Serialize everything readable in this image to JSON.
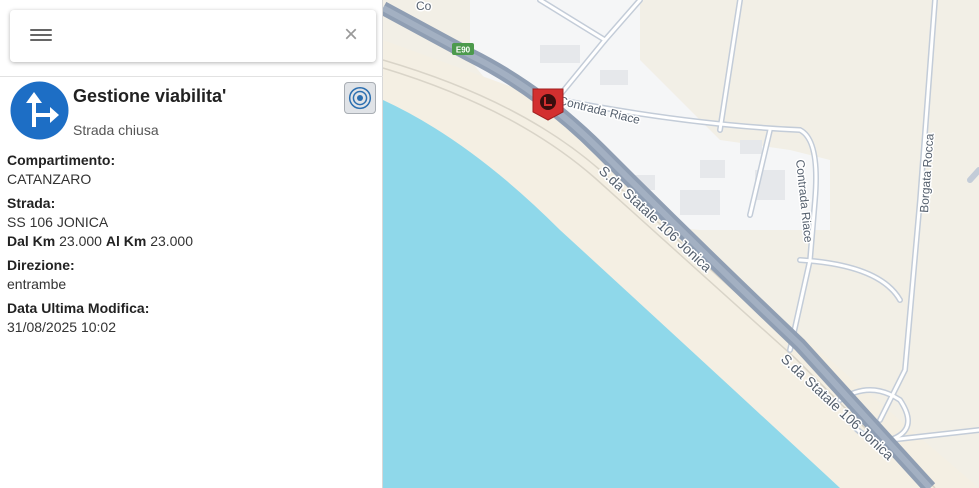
{
  "search": {
    "close_label": "×"
  },
  "event": {
    "title": "Gestione viabilita'",
    "subtitle": "Strada chiusa",
    "compartimento_label": "Compartimento:",
    "compartimento_value": "CATANZARO",
    "strada_label": "Strada:",
    "strada_value": "SS 106 JONICA",
    "dal_km_label": "Dal Km",
    "dal_km_value": "23.000",
    "al_km_label": "Al Km",
    "al_km_value": "23.000",
    "direzione_label": "Direzione:",
    "direzione_value": "entrambe",
    "data_label": "Data Ultima Modifica:",
    "data_value": "31/08/2025 10:02"
  },
  "map": {
    "shield_e90": "E90",
    "label_contrada_riace_1": "Contrada Riace",
    "label_contrada_riace_2": "Contrada Riace",
    "label_statale_1": "S.da Statale 106 Jonica",
    "label_statale_2": "S.da Statale 106 Jonica",
    "label_borgata_rocca": "Borgata Rocca",
    "label_corner": "Co",
    "colors": {
      "sea": "#8fd8ea",
      "beach": "#f5f0e6",
      "land": "#f2efe6",
      "urban": "#f4f5f6",
      "road_main": "#8f9eb3",
      "road_minor": "#c0cad7",
      "closure_marker": "#d32f2f",
      "event_icon": "#1d6ec5"
    }
  }
}
